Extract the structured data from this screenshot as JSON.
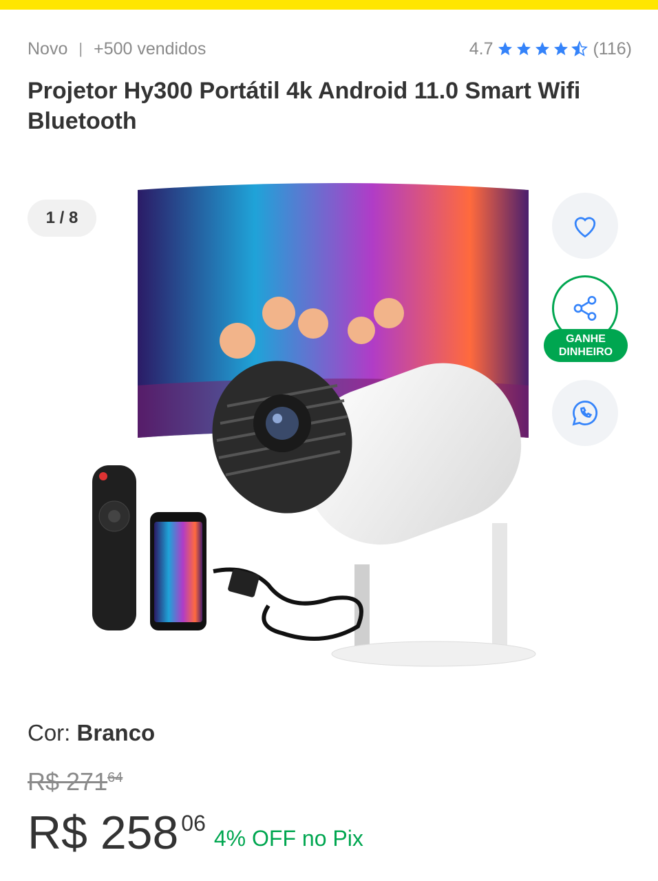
{
  "header": {
    "accent_color": "#ffe600"
  },
  "meta": {
    "condition": "Novo",
    "separator": "|",
    "sold": "+500 vendidos",
    "rating_value": "4.7",
    "rating_stars": 4.5,
    "rating_count": "(116)",
    "star_color": "#3483fa"
  },
  "product": {
    "title": "Projetor Hy300 Portátil 4k Android 11.0 Smart Wifi Bluetooth"
  },
  "gallery": {
    "counter": "1 / 8",
    "image_alt": "product-image-projector"
  },
  "actions": {
    "favorite_icon": "heart-icon",
    "share_icon": "share-icon",
    "earn_label_line1": "GANHE",
    "earn_label_line2": "DINHEIRO",
    "whatsapp_icon": "whatsapp-icon",
    "earn_color": "#00a650"
  },
  "variant": {
    "label": "Cor:",
    "value": "Branco"
  },
  "pricing": {
    "old_currency_int": "R$ 271",
    "old_cents": "64",
    "currency_int": "R$ 258",
    "cents": "06",
    "pix_discount": "4% OFF no Pix",
    "pix_color": "#00a650"
  }
}
